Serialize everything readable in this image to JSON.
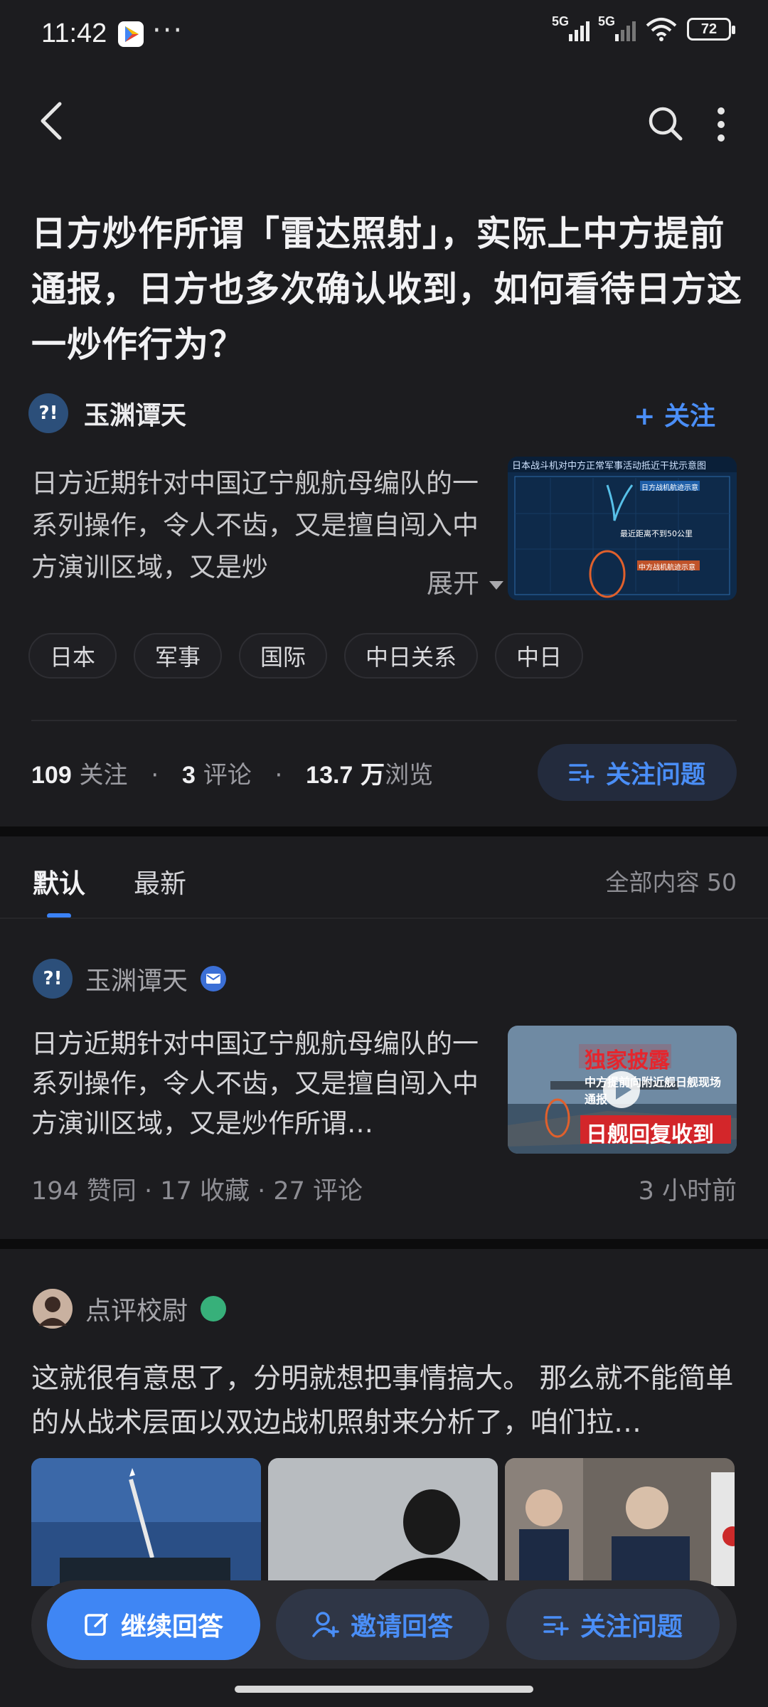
{
  "status_bar": {
    "time": "11:42",
    "more": "···",
    "signal1_label": "5G",
    "signal2_label": "5G",
    "battery": "72"
  },
  "header": {
    "back_icon": "chevron-left-icon",
    "search_icon": "search-icon",
    "more_icon": "more-vertical-icon"
  },
  "question": {
    "title": "日方炒作所谓「雷达照射」，实际上中方提前通报，日方也多次确认收到，如何看待日方这一炒作行为？",
    "author_name": "玉渊谭天",
    "avatar_text": "?!",
    "follow_label": "+ 关注",
    "description": "日方近期针对中国辽宁舰航母编队的一系列操作，令人不齿，又是擅自闯入中方演训区域，又是炒",
    "expand_label": "展开",
    "thumb_caption": "日本战斗机对中方正常军事活动抵近干扰示意图",
    "thumb_label_a": "日方战机航迹示意",
    "thumb_label_b": "最近距离不到50公里",
    "thumb_label_c": "中方战机航迹示意",
    "tags": [
      "日本",
      "军事",
      "国际",
      "中日关系",
      "中日"
    ],
    "stats": {
      "followers_num": "109",
      "followers_label": "关注",
      "comments_num": "3",
      "comments_label": "评论",
      "views_num": "13.7",
      "views_unit": "万",
      "views_label": "浏览"
    },
    "follow_question_label": "关注问题"
  },
  "tabs": {
    "default": "默认",
    "latest": "最新",
    "all_count": "全部内容 50"
  },
  "answers": [
    {
      "author": "玉渊谭天",
      "text": "日方近期针对中国辽宁舰航母编队的一系列操作，令人不齿，又是擅自闯入中方演训区域，又是炒作所谓…",
      "thumb_title": "独家披露",
      "thumb_sub": "中方提前向附近舰日舰现场通报",
      "thumb_banner": "日舰回复收到",
      "meta": "194 赞同 · 17 收藏 · 27 评论",
      "time": "3 小时前"
    },
    {
      "author": "点评校尉",
      "text": "这就很有意思了，分明就想把事情搞大。 那么就不能简单的从战术层面以双边战机照射来分析了，咱们拉…"
    }
  ],
  "bottom_bar": {
    "continue_label": "继续回答",
    "invite_label": "邀请回答",
    "follow_label": "关注问题"
  },
  "colors": {
    "background": "#1c1c1f",
    "accent": "#3f86f4",
    "link": "#4a8ef7"
  }
}
